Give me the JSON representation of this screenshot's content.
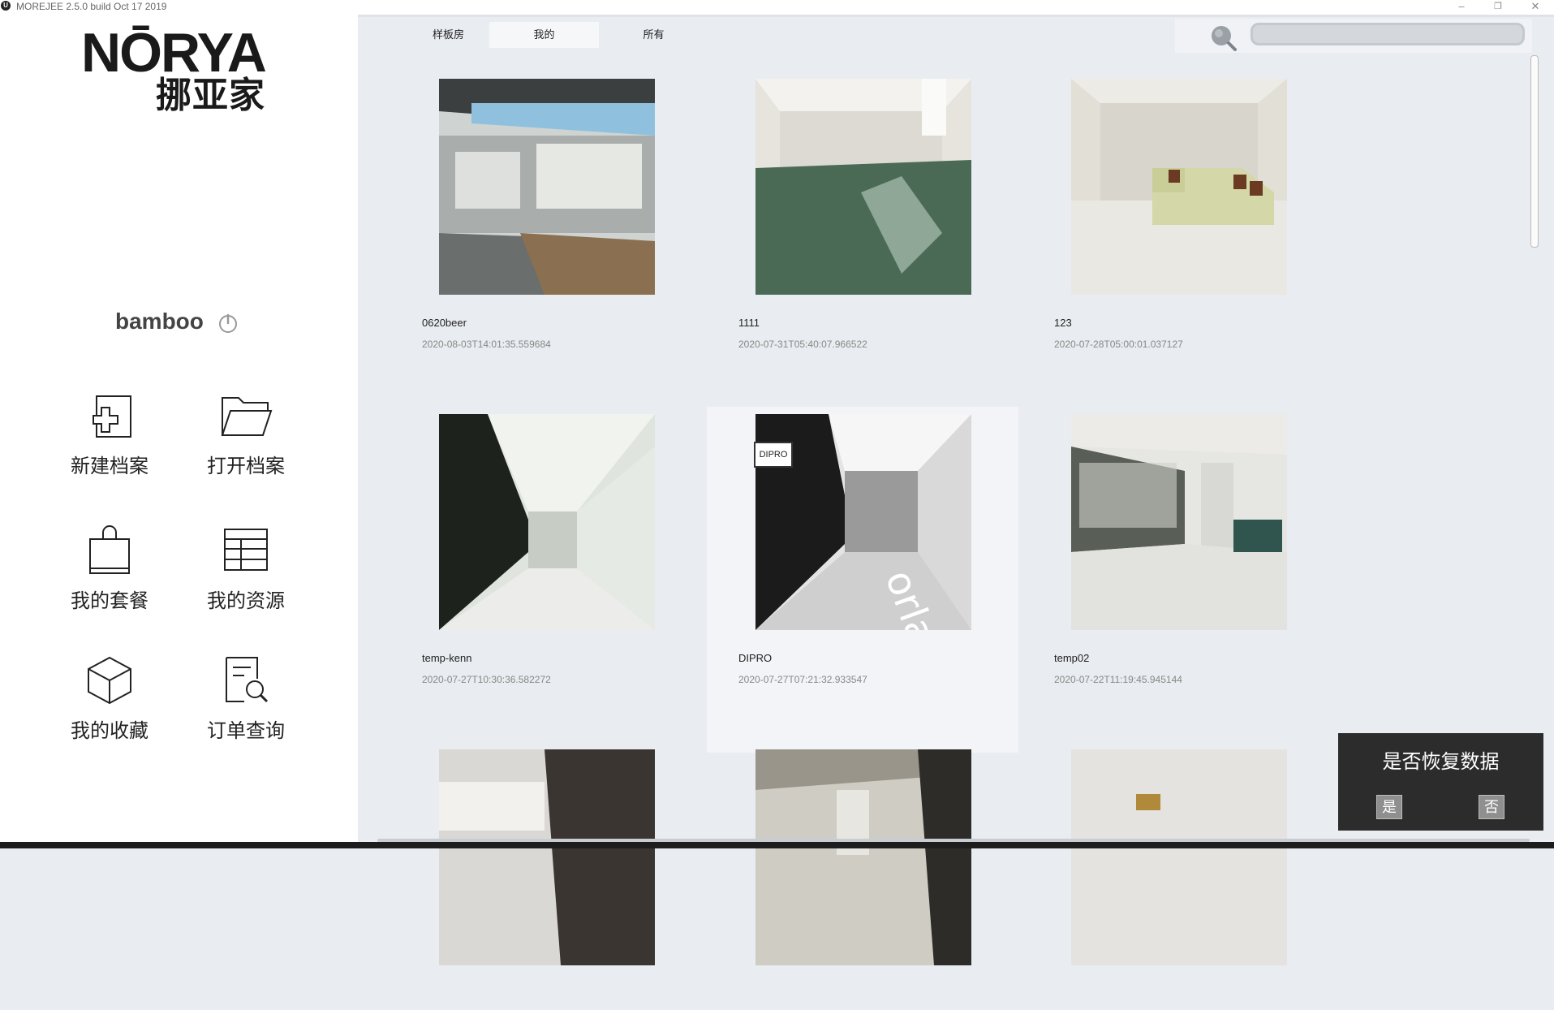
{
  "window": {
    "title": "MOREJEE 2.5.0 build Oct 17 2019",
    "app_icon_letter": "U",
    "minimize": "–",
    "restore": "❐",
    "close": "✕"
  },
  "sidebar": {
    "logo_en": "NŌRYA",
    "logo_cn": "挪亚家",
    "username": "bamboo",
    "items": [
      {
        "label": "新建档案",
        "icon": "new-archive-icon"
      },
      {
        "label": "打开档案",
        "icon": "folder-open-icon"
      },
      {
        "label": "我的套餐",
        "icon": "shopping-bag-icon"
      },
      {
        "label": "我的资源",
        "icon": "grid-icon"
      },
      {
        "label": "我的收藏",
        "icon": "cube-icon"
      },
      {
        "label": "订单查询",
        "icon": "document-search-icon"
      }
    ]
  },
  "tabs": [
    {
      "label": "样板房",
      "active": false
    },
    {
      "label": "我的",
      "active": true
    },
    {
      "label": "所有",
      "active": false
    }
  ],
  "search": {
    "placeholder": "",
    "value": ""
  },
  "projects": [
    {
      "name": "0620beer",
      "date": "2020-08-03T14:01:35.559684"
    },
    {
      "name": "1111",
      "date": "2020-07-31T05:40:07.966522"
    },
    {
      "name": "123",
      "date": "2020-07-28T05:00:01.037127"
    },
    {
      "name": "temp-kenn",
      "date": "2020-07-27T10:30:36.582272"
    },
    {
      "name": "DIPRO",
      "date": "2020-07-27T07:21:32.933547",
      "badge": "DIPRO"
    },
    {
      "name": "temp02",
      "date": "2020-07-22T11:19:45.945144"
    },
    {
      "name": "",
      "date": ""
    },
    {
      "name": "",
      "date": ""
    },
    {
      "name": "",
      "date": ""
    }
  ],
  "dialog": {
    "message": "是否恢复数据",
    "yes": "是",
    "no": "否"
  }
}
